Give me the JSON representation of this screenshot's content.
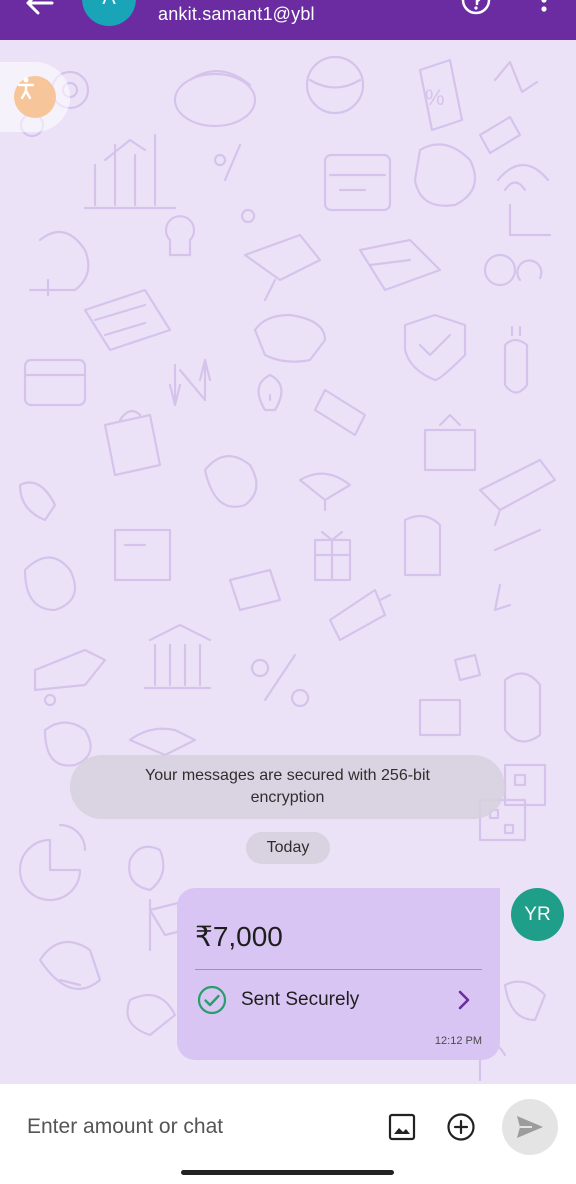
{
  "header": {
    "contact_initial": "A",
    "contact_upi": "ankit.samant1@ybl",
    "bg_color": "#6a2ca0"
  },
  "chat": {
    "security_notice": "Your messages are secured with 256-bit encryption",
    "date_chip": "Today"
  },
  "payment": {
    "amount": "₹7,000",
    "status": "Sent Securely",
    "time": "12:12 PM",
    "sender_initials": "YR"
  },
  "composer": {
    "placeholder": "Enter amount or chat"
  },
  "icons": {
    "back": "back-arrow-icon",
    "help": "help-icon",
    "more": "more-vertical-icon",
    "accessibility": "accessibility-icon",
    "check": "check-circle-icon",
    "chevron": "chevron-right-icon",
    "gallery": "gallery-icon",
    "add": "add-circle-icon",
    "send": "send-icon"
  },
  "colors": {
    "chat_bg": "#ece2f7",
    "bubble": "#d9c5f3",
    "avatar_contact": "#1aa4b8",
    "avatar_self": "#1f9e8a",
    "success": "#2a9d6b"
  }
}
